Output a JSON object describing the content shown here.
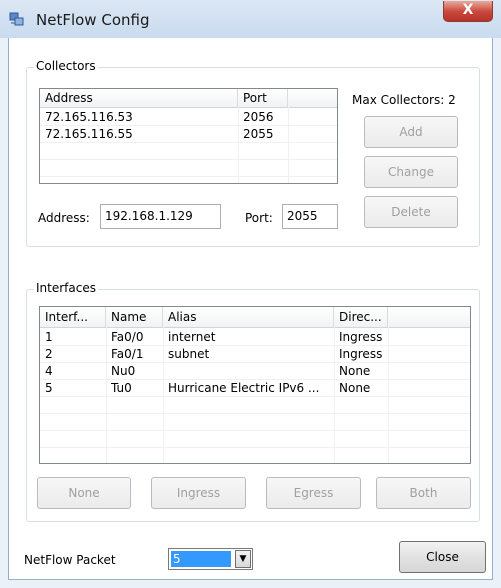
{
  "window": {
    "title": "NetFlow Config",
    "close_glyph": "X",
    "icon": "netflow-app-icon"
  },
  "collectors": {
    "group_label": "Collectors",
    "columns": [
      "Address",
      "Port",
      ""
    ],
    "rows": [
      {
        "address": "72.165.116.53",
        "port": "2056"
      },
      {
        "address": "72.165.116.55",
        "port": "2055"
      }
    ],
    "max_label": "Max Collectors: 2",
    "buttons": {
      "add": "Add",
      "change": "Change",
      "delete": "Delete"
    },
    "address_label": "Address:",
    "address_value": "192.168.1.129",
    "port_label": "Port:",
    "port_value": "2055"
  },
  "interfaces": {
    "group_label": "Interfaces",
    "columns": [
      "Interf...",
      "Name",
      "Alias",
      "Direc...",
      ""
    ],
    "rows": [
      {
        "interface": "1",
        "name": "Fa0/0",
        "alias": "internet",
        "direction": "Ingress"
      },
      {
        "interface": "2",
        "name": "Fa0/1",
        "alias": "subnet",
        "direction": "Ingress"
      },
      {
        "interface": "4",
        "name": "Nu0",
        "alias": "",
        "direction": "None"
      },
      {
        "interface": "5",
        "name": "Tu0",
        "alias": "Hurricane Electric IPv6 ...",
        "direction": "None"
      }
    ],
    "buttons": {
      "none": "None",
      "ingress": "Ingress",
      "egress": "Egress",
      "both": "Both"
    }
  },
  "footer": {
    "packet_label": "NetFlow Packet",
    "packet_value": "5",
    "close_label": "Close"
  }
}
